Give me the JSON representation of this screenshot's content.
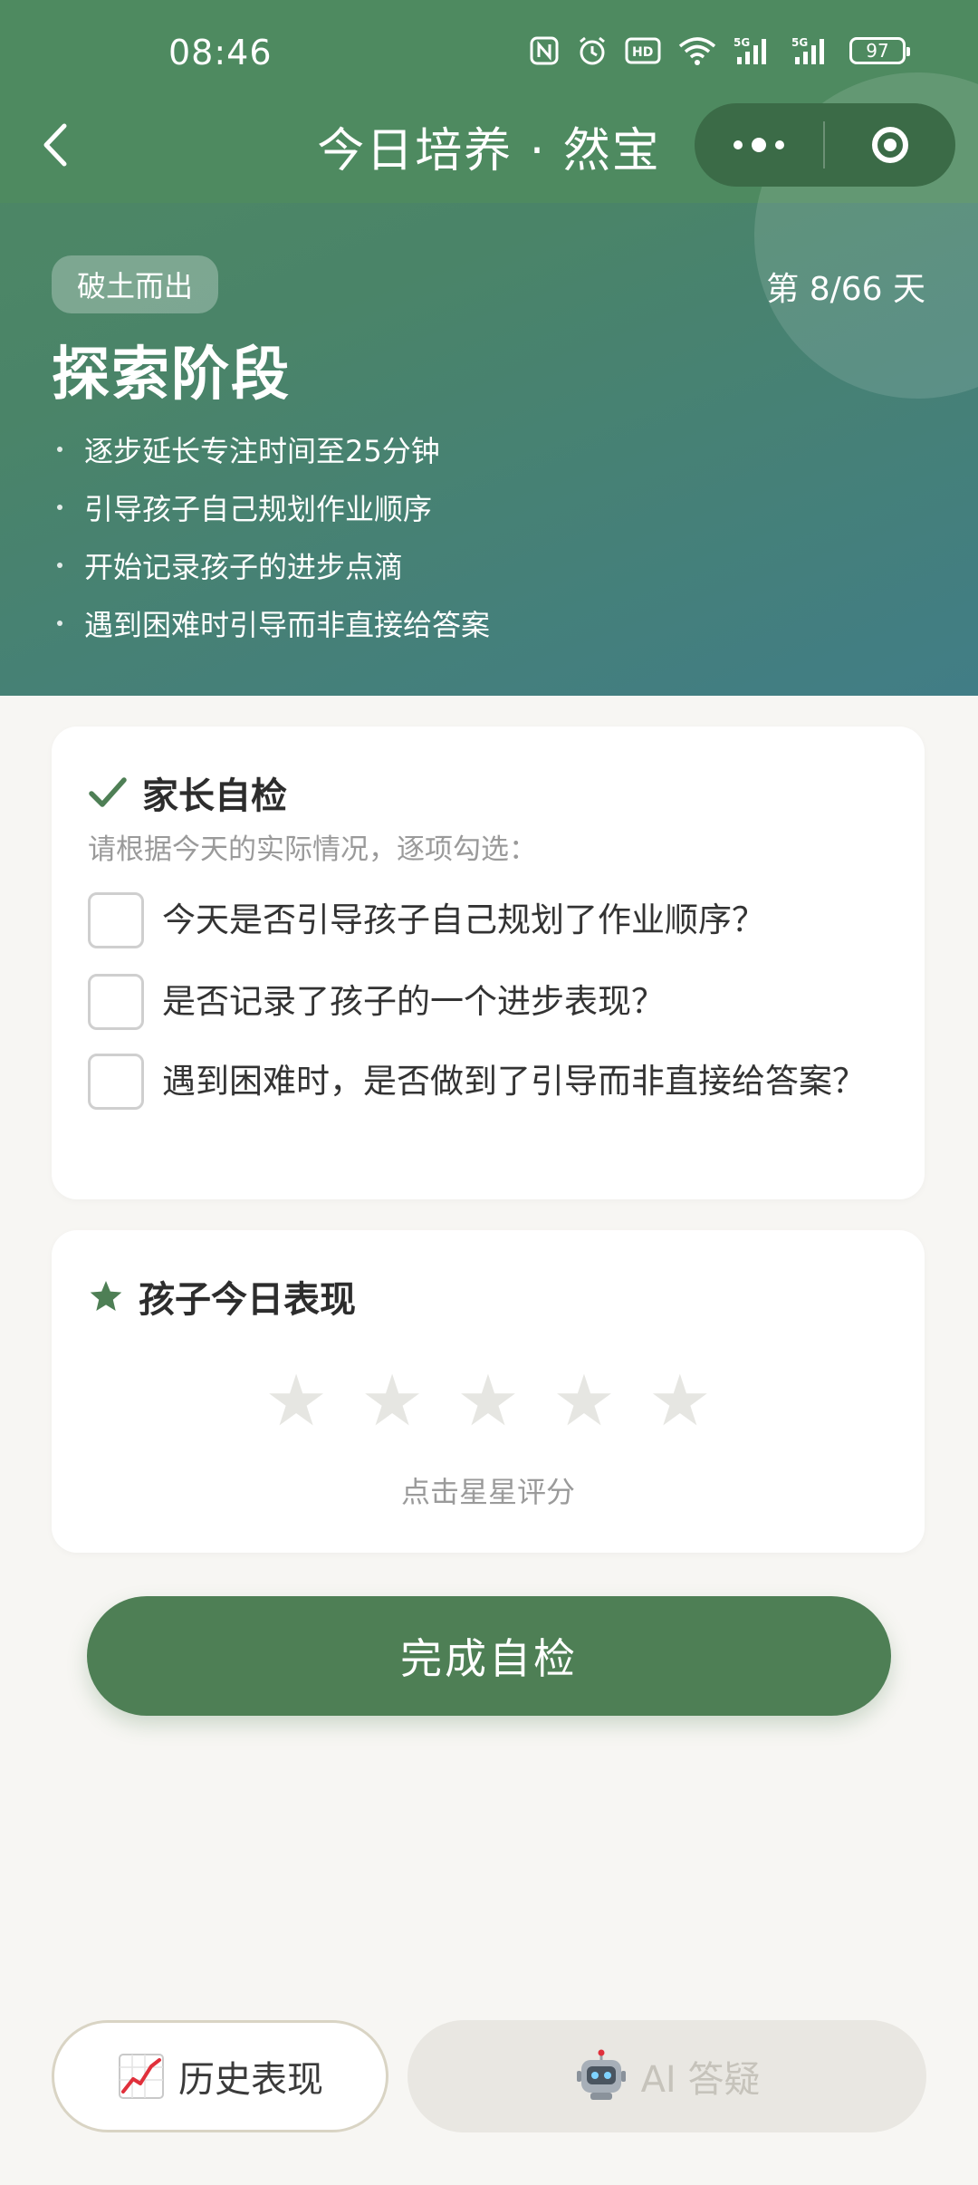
{
  "status_bar": {
    "time": "08:46",
    "battery": "97"
  },
  "nav": {
    "title": "今日培养 · 然宝"
  },
  "stage": {
    "badge": "破土而出",
    "day_counter": "第 8/66 天",
    "title": "探索阶段",
    "goals": [
      "逐步延长专注时间至25分钟",
      "引导孩子自己规划作业顺序",
      "开始记录孩子的进步点滴",
      "遇到困难时引导而非直接给答案"
    ]
  },
  "checklist": {
    "title": "家长自检",
    "instruction": "请根据今天的实际情况，逐项勾选：",
    "items": [
      {
        "label": "今天是否引导孩子自己规划了作业顺序？",
        "checked": false
      },
      {
        "label": "是否记录了孩子的一个进步表现？",
        "checked": false
      },
      {
        "label": "遇到困难时，是否做到了引导而非直接给答案？",
        "checked": false
      }
    ]
  },
  "rating": {
    "title": "孩子今日表现",
    "hint": "点击星星评分",
    "value": 0,
    "max": 5
  },
  "actions": {
    "submit_label": "完成自检",
    "history_label": "历史表现",
    "ai_label": "AI 答疑"
  },
  "colors": {
    "accent": "#4e7f55",
    "header_top": "#4e8a60",
    "header_bottom": "#417d86",
    "star_inactive": "#e6e6e2"
  },
  "icons": {
    "back": "chevron-left-icon",
    "more": "more-dots-icon",
    "close": "mini-program-close-icon",
    "check": "checkmark-icon",
    "star": "star-icon",
    "history": "chart-increasing-icon",
    "ai": "robot-icon"
  }
}
